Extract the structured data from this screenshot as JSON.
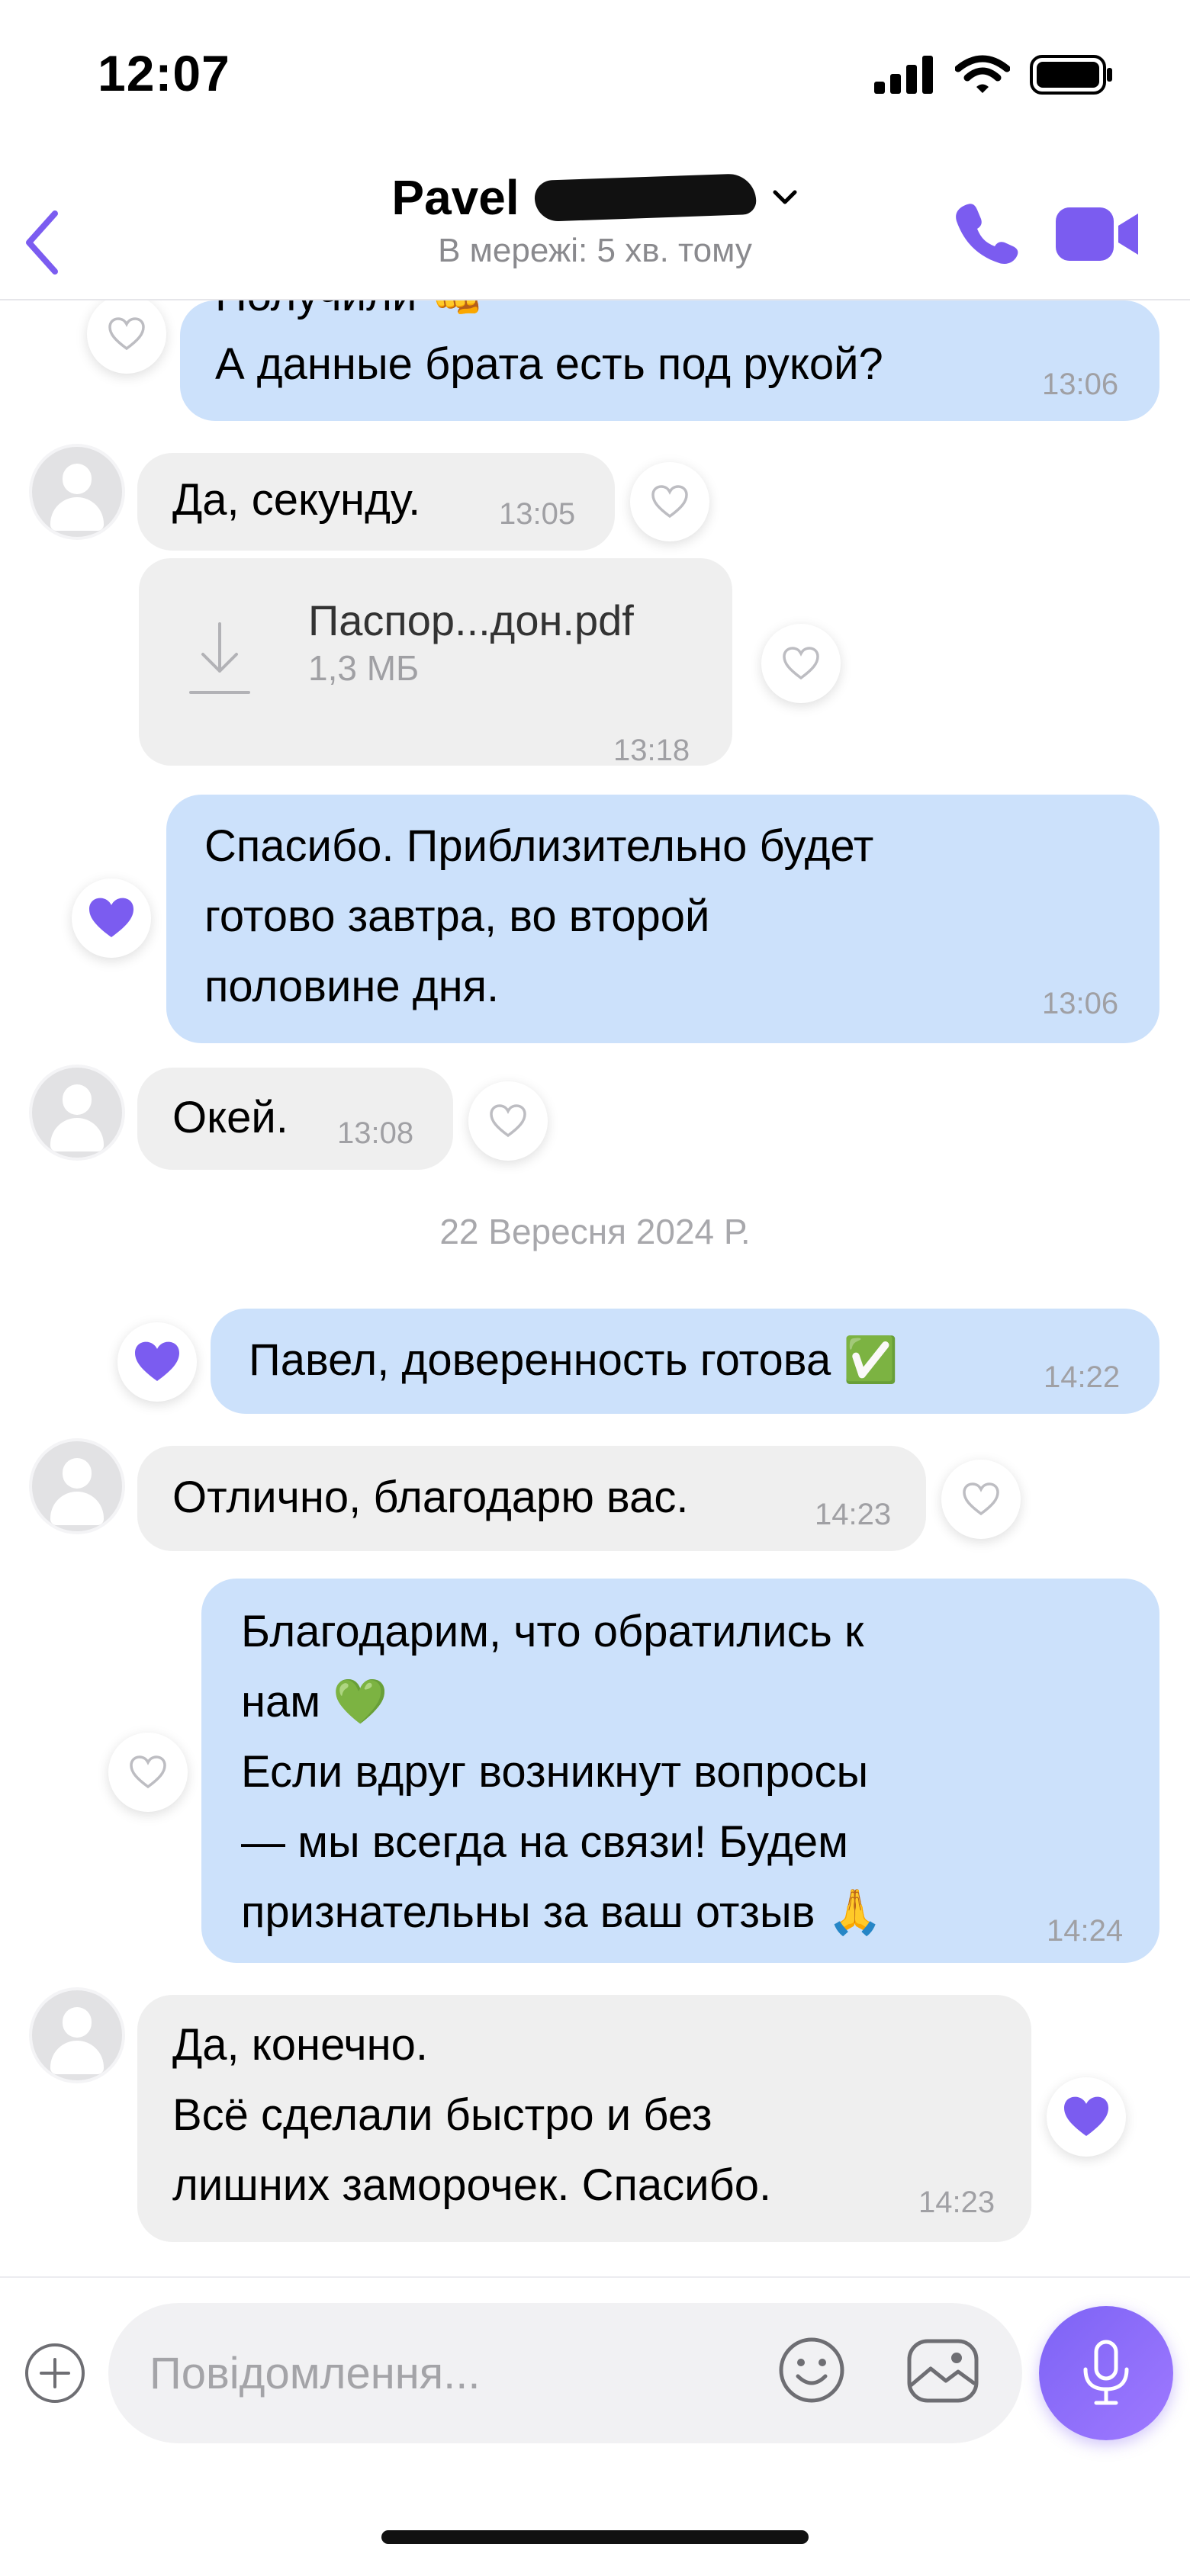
{
  "status": {
    "time": "12:07"
  },
  "header": {
    "contact_name": "Pavel",
    "presence": "В мережі: 5 хв. тому"
  },
  "colors": {
    "accent": "#7b5cf0",
    "outgoing_bubble": "#cce1fb",
    "incoming_bubble": "#efefef"
  },
  "messages": [
    {
      "direction": "out",
      "text_top_partial": "Получили 👊",
      "text": "А данные брата есть под рукой?",
      "time": "13:06",
      "liked": false
    },
    {
      "direction": "in",
      "text": "Да, секунду.",
      "time": "13:05",
      "liked": false
    },
    {
      "direction": "in",
      "type": "file",
      "file_name": "Паспор...дон.pdf",
      "file_size": "1,3 МБ",
      "time": "13:18",
      "liked": false
    },
    {
      "direction": "out",
      "lines": [
        "Спасибо. Приблизительно будет",
        "готово завтра, во второй",
        "половине дня."
      ],
      "time": "13:06",
      "liked": true
    },
    {
      "direction": "in",
      "text": "Окей.",
      "time": "13:08",
      "liked": false
    },
    {
      "direction": "out",
      "text": "Павел, доверенность готова ✅",
      "time": "14:22",
      "liked": true
    },
    {
      "direction": "in",
      "text": "Отлично, благодарю вас.",
      "time": "14:23",
      "liked": false
    },
    {
      "direction": "out",
      "lines": [
        "Благодарим, что обратились к",
        "нам 💚",
        "Если вдруг возникнут вопросы",
        "— мы всегда на связи! Будем",
        "признательны за ваш отзыв 🙏"
      ],
      "time": "14:24",
      "liked": false
    },
    {
      "direction": "in",
      "lines": [
        "Да, конечно.",
        "Всё сделали быстро и без",
        "лишних заморочек. Спасибо."
      ],
      "time": "14:23",
      "liked": true
    }
  ],
  "date_separator": "22 Вересня 2024 Р.",
  "composer": {
    "placeholder": "Повідомлення..."
  },
  "icons": [
    "back-chevron-icon",
    "phone-icon",
    "video-camera-icon",
    "heart-icon",
    "download-icon",
    "plus-icon",
    "emoji-icon",
    "gallery-icon",
    "microphone-icon",
    "signal-icon",
    "wifi-icon",
    "battery-icon"
  ]
}
